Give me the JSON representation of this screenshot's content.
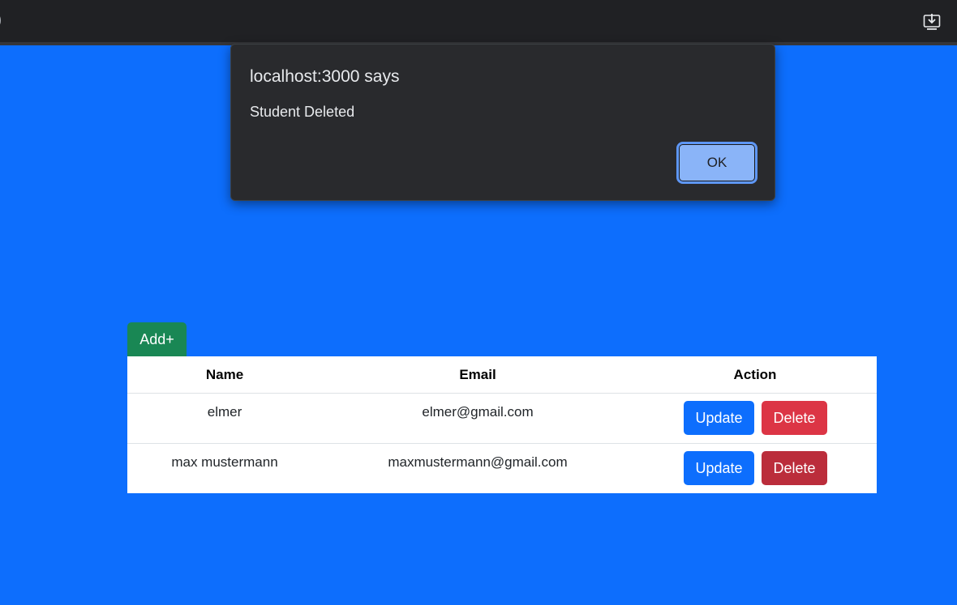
{
  "browser": {
    "edge_text": ")",
    "download_icon": "download-to-device-icon"
  },
  "alert": {
    "title": "localhost:3000 says",
    "message": "Student Deleted",
    "ok_label": "OK"
  },
  "toolbar": {
    "add_label": "Add+"
  },
  "table": {
    "headers": [
      "Name",
      "Email",
      "Action"
    ],
    "rows": [
      {
        "name": "elmer",
        "email": "elmer@gmail.com",
        "update_label": "Update",
        "delete_label": "Delete"
      },
      {
        "name": "max mustermann",
        "email": "maxmustermann@gmail.com",
        "update_label": "Update",
        "delete_label": "Delete"
      }
    ]
  },
  "colors": {
    "page_background": "#0d6efd",
    "add_button": "#198754",
    "update_button": "#0d6efd",
    "delete_button": "#dc3545",
    "dialog_background": "#292a2d",
    "dialog_ok_button": "#8ab4f8"
  }
}
